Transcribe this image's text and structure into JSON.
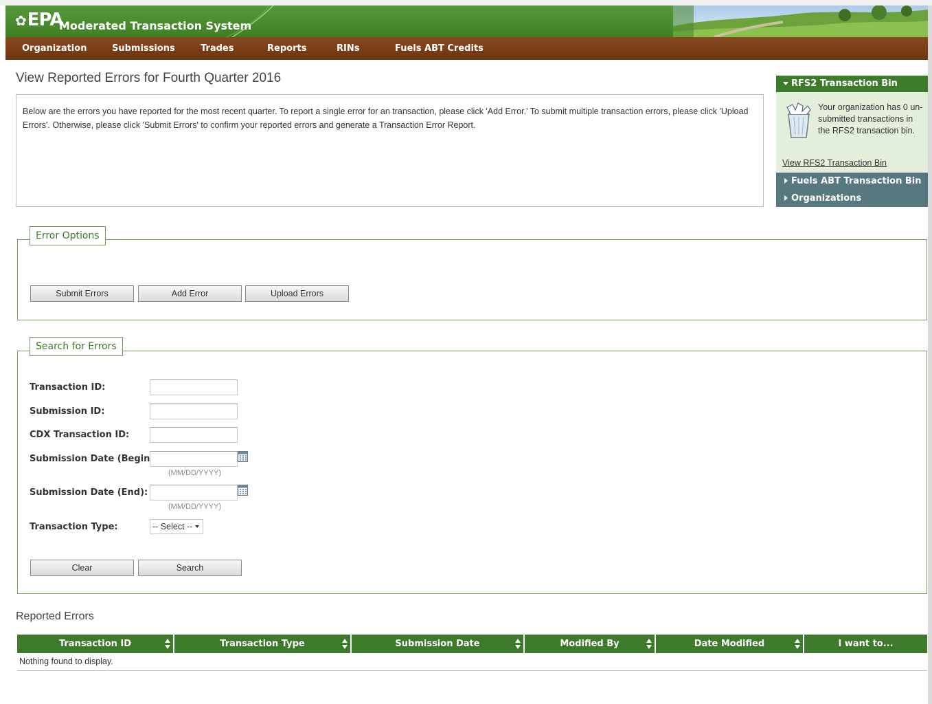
{
  "header": {
    "logo": "EPA",
    "title": "Moderated Transaction System"
  },
  "nav": [
    "Organization",
    "Submissions",
    "Trades",
    "Reports",
    "RINs",
    "Fuels ABT Credits"
  ],
  "page": {
    "title": "View Reported Errors for Fourth Quarter 2016",
    "info": "Below are the errors you have reported for the most recent quarter. To report a single error for an transaction, please click 'Add Error.' To submit multiple transaction errors, please click 'Upload Errors'. Otherwise, please click 'Submit Errors' to confirm your reported errors and generate a Transaction Error Report."
  },
  "sidebar": {
    "rfs2_header": "RFS2 Transaction Bin",
    "rfs2_text": "Your organization has 0 un-submitted transactions in the RFS2 transaction bin.",
    "rfs2_link": "View RFS2 Transaction Bin",
    "fuels_abt": "Fuels ABT Transaction Bin",
    "organizations": "Organizations"
  },
  "error_options": {
    "legend": "Error Options",
    "submit": "Submit Errors",
    "add": "Add Error",
    "upload": "Upload Errors"
  },
  "search": {
    "legend": "Search for Errors",
    "transaction_id": "Transaction ID:",
    "submission_id": "Submission ID:",
    "cdx_id": "CDX Transaction ID:",
    "date_begin": "Submission Date (Begin):",
    "date_end": "Submission Date (End):",
    "date_hint": "(MM/DD/YYYY)",
    "type": "Transaction Type:",
    "type_value": "-- Select --",
    "clear": "Clear",
    "search": "Search"
  },
  "results": {
    "title": "Reported Errors",
    "columns": [
      "Transaction ID",
      "Transaction Type",
      "Submission Date",
      "Modified By",
      "Date Modified",
      "I want to..."
    ],
    "empty": "Nothing found to display."
  }
}
